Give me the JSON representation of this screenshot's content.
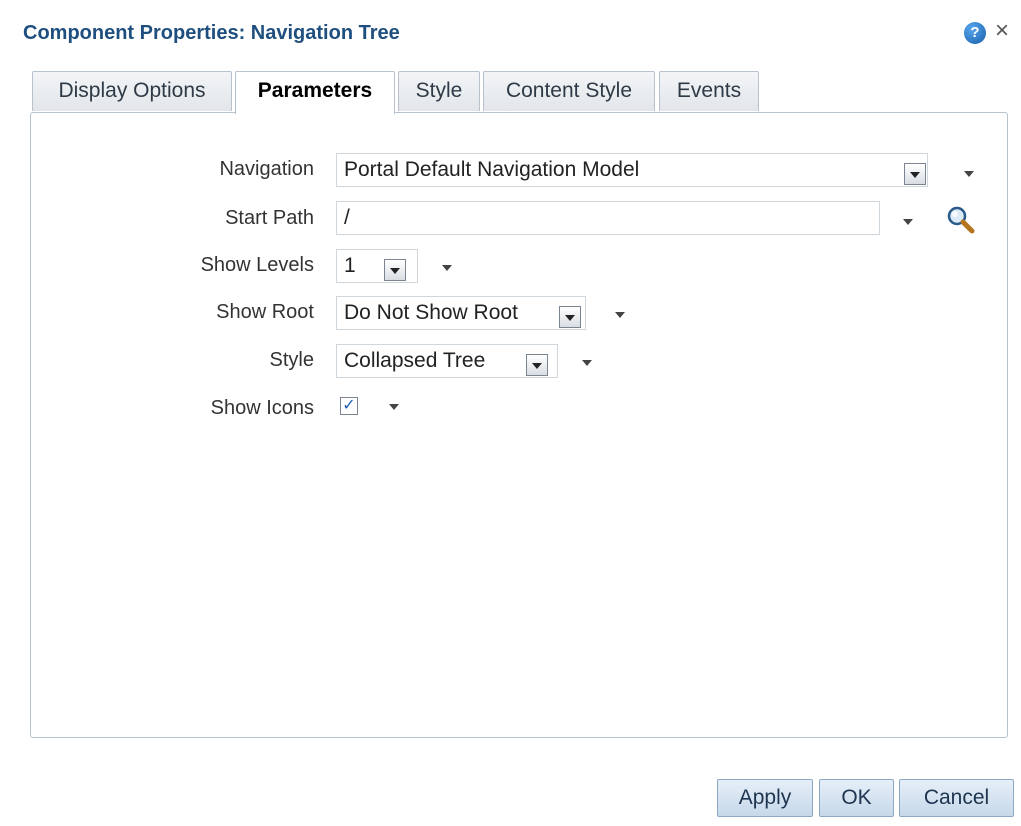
{
  "dialog": {
    "title": "Component Properties: Navigation Tree",
    "help_icon": "help-icon",
    "close_icon": "close-icon",
    "close_glyph": "×"
  },
  "tabs": [
    {
      "label": "Display Options",
      "active": false
    },
    {
      "label": "Parameters",
      "active": true
    },
    {
      "label": "Style",
      "active": false
    },
    {
      "label": "Content Style",
      "active": false
    },
    {
      "label": "Events",
      "active": false
    }
  ],
  "fields": {
    "navigation": {
      "label": "Navigation",
      "value": "Portal Default Navigation Model"
    },
    "start_path": {
      "label": "Start Path",
      "value": "/"
    },
    "show_levels": {
      "label": "Show Levels",
      "value": "1"
    },
    "show_root": {
      "label": "Show Root",
      "value": "Do Not Show Root"
    },
    "style": {
      "label": "Style",
      "value": "Collapsed Tree"
    },
    "show_icons": {
      "label": "Show Icons",
      "checked": true
    }
  },
  "buttons": {
    "apply": "Apply",
    "ok": "OK",
    "cancel": "Cancel"
  },
  "colors": {
    "title": "#1f4f7f",
    "tab_border": "#b8c2cc",
    "button_bg": "#c6d8ea"
  }
}
